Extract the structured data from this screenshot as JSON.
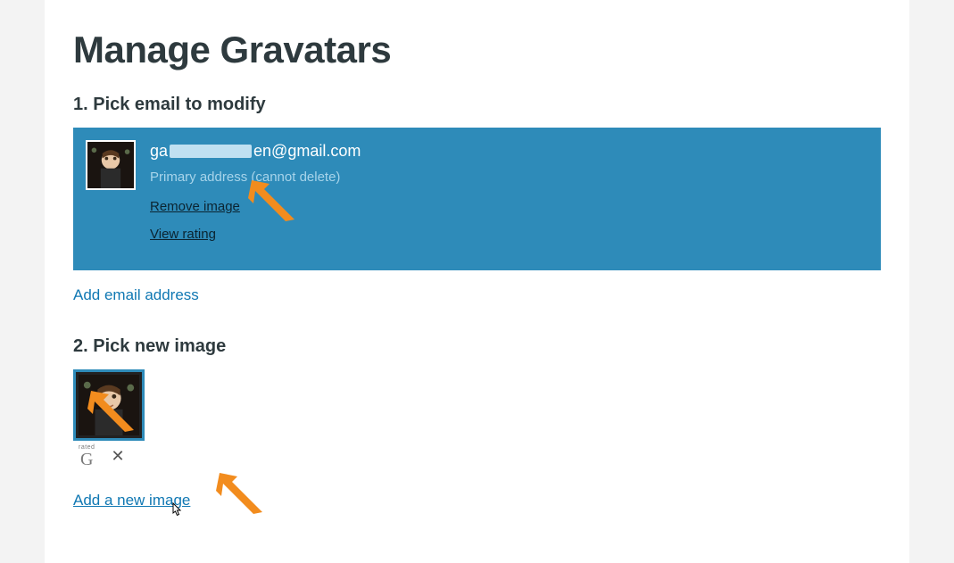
{
  "page": {
    "title": "Manage Gravatars"
  },
  "step1": {
    "heading": "1. Pick email to modify",
    "email": {
      "prefix": "ga",
      "suffix": "en@gmail.com",
      "note": "Primary address (cannot delete)",
      "remove_link": "Remove image",
      "rating_link": "View rating"
    },
    "add_email_link": "Add email address"
  },
  "step2": {
    "heading": "2. Pick new image",
    "rating_label": "rated",
    "rating_value": "G",
    "add_image_link": "Add a new image"
  },
  "colors": {
    "accent": "#2e8bb9",
    "link": "#1078b3",
    "arrow": "#f28c1e"
  }
}
